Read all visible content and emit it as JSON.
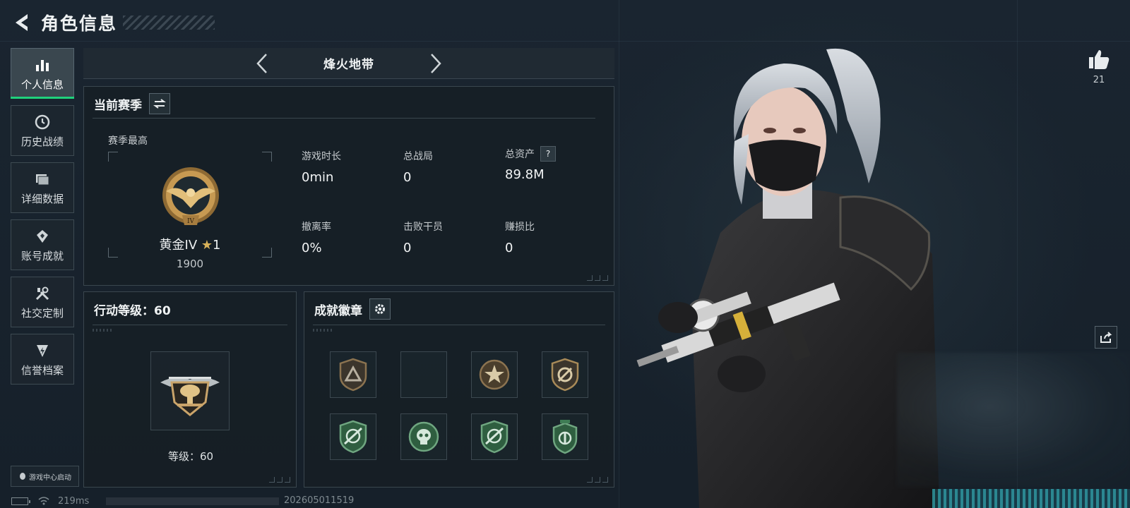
{
  "header": {
    "title": "角色信息"
  },
  "sidenav": {
    "items": [
      {
        "label": "个人信息",
        "icon": "bar-chart-icon",
        "active": true
      },
      {
        "label": "历史战绩",
        "icon": "history-clock-icon",
        "active": false
      },
      {
        "label": "详细数据",
        "icon": "folders-icon",
        "active": false
      },
      {
        "label": "账号成就",
        "icon": "achievement-icon",
        "active": false
      },
      {
        "label": "社交定制",
        "icon": "tools-icon",
        "active": false
      },
      {
        "label": "信誉档案",
        "icon": "reputation-icon",
        "active": false
      }
    ],
    "game_center": "游戏中心启动"
  },
  "mode": {
    "title": "烽火地带"
  },
  "season": {
    "title": "当前赛季",
    "best_label": "赛季最高",
    "rank_name": "黄金IV",
    "rank_stars": "1",
    "rank_score": "1900",
    "stats": [
      {
        "label": "游戏时长",
        "value": "0min"
      },
      {
        "label": "总战局",
        "value": "0"
      },
      {
        "label": "总资产",
        "value": "89.8M",
        "help": "?"
      },
      {
        "label": "撤离率",
        "value": "0%"
      },
      {
        "label": "击败干员",
        "value": "0"
      },
      {
        "label": "赚损比",
        "value": "0"
      }
    ]
  },
  "ops_level": {
    "title": "行动等级：60",
    "level_text": "等级：60"
  },
  "badges": {
    "title": "成就徽章",
    "slots": [
      {
        "icon": "triangle-shield-badge-icon",
        "filled": true
      },
      {
        "icon": "empty-badge-slot",
        "filled": false
      },
      {
        "icon": "star-circle-badge-icon",
        "filled": true
      },
      {
        "icon": "slashed-shield-badge-icon",
        "filled": true
      },
      {
        "icon": "green-rifle-shield-badge-icon",
        "filled": true
      },
      {
        "icon": "green-skull-badge-icon",
        "filled": true
      },
      {
        "icon": "green-rifle-shield-badge-icon",
        "filled": true
      },
      {
        "icon": "green-emblem-badge-icon",
        "filled": true
      }
    ]
  },
  "social": {
    "like_count": "21"
  },
  "status": {
    "ping": "219ms",
    "build": "202605011519"
  },
  "colors": {
    "accent": "#1fd17c",
    "gold": "#d8b25a",
    "badge_green": "#3f7d55",
    "badge_bronze": "#8b7350"
  }
}
